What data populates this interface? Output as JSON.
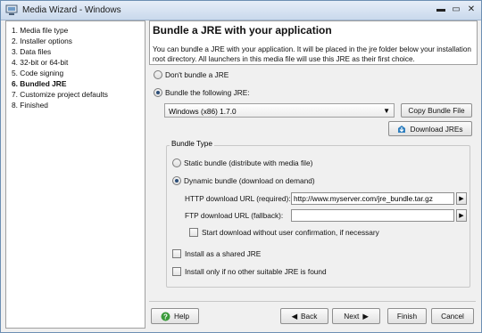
{
  "window": {
    "title": "Media Wizard - Windows"
  },
  "sidebar": {
    "steps": [
      {
        "label": "1. Media file type"
      },
      {
        "label": "2. Installer options"
      },
      {
        "label": "3. Data files"
      },
      {
        "label": "4. 32-bit or 64-bit"
      },
      {
        "label": "5. Code signing"
      },
      {
        "label": "6. Bundled JRE"
      },
      {
        "label": "7. Customize project defaults"
      },
      {
        "label": "8. Finished"
      }
    ],
    "active_index": 5
  },
  "header": {
    "title": "Bundle a JRE with your application",
    "description": "You can bundle a JRE with your application. It will be placed in the jre folder below your installation root directory. All launchers in this media file will use this JRE as their first choice."
  },
  "options": {
    "dont_bundle": {
      "label": "Don't bundle a JRE",
      "selected": false
    },
    "bundle_following": {
      "label": "Bundle the following JRE:",
      "selected": true
    }
  },
  "jre_select": {
    "value": "Windows (x86) 1.7.0"
  },
  "copy_bundle_label": "Copy Bundle File",
  "download_jres_label": "Download JREs",
  "bundle_type": {
    "title": "Bundle Type",
    "static": {
      "label": "Static bundle (distribute with media file)",
      "selected": false
    },
    "dynamic": {
      "label": "Dynamic bundle (download on demand)",
      "selected": true
    },
    "http_label": "HTTP download URL (required):",
    "http_value": "http://www.myserver.com/jre_bundle.tar.gz",
    "ftp_label": "FTP download URL (fallback):",
    "ftp_value": "",
    "start_download_label": "Start download without user confirmation, if necessary",
    "shared_label": "Install as a shared JRE",
    "only_if_label": "Install only if no other suitable JRE is found"
  },
  "footer": {
    "help": "Help",
    "back": "Back",
    "next": "Next",
    "finish": "Finish",
    "cancel": "Cancel"
  },
  "colors": {
    "radio_dot": "#2c4e78",
    "help_icon": "#3a9a3a",
    "download_icon": "#2f7fbf"
  }
}
